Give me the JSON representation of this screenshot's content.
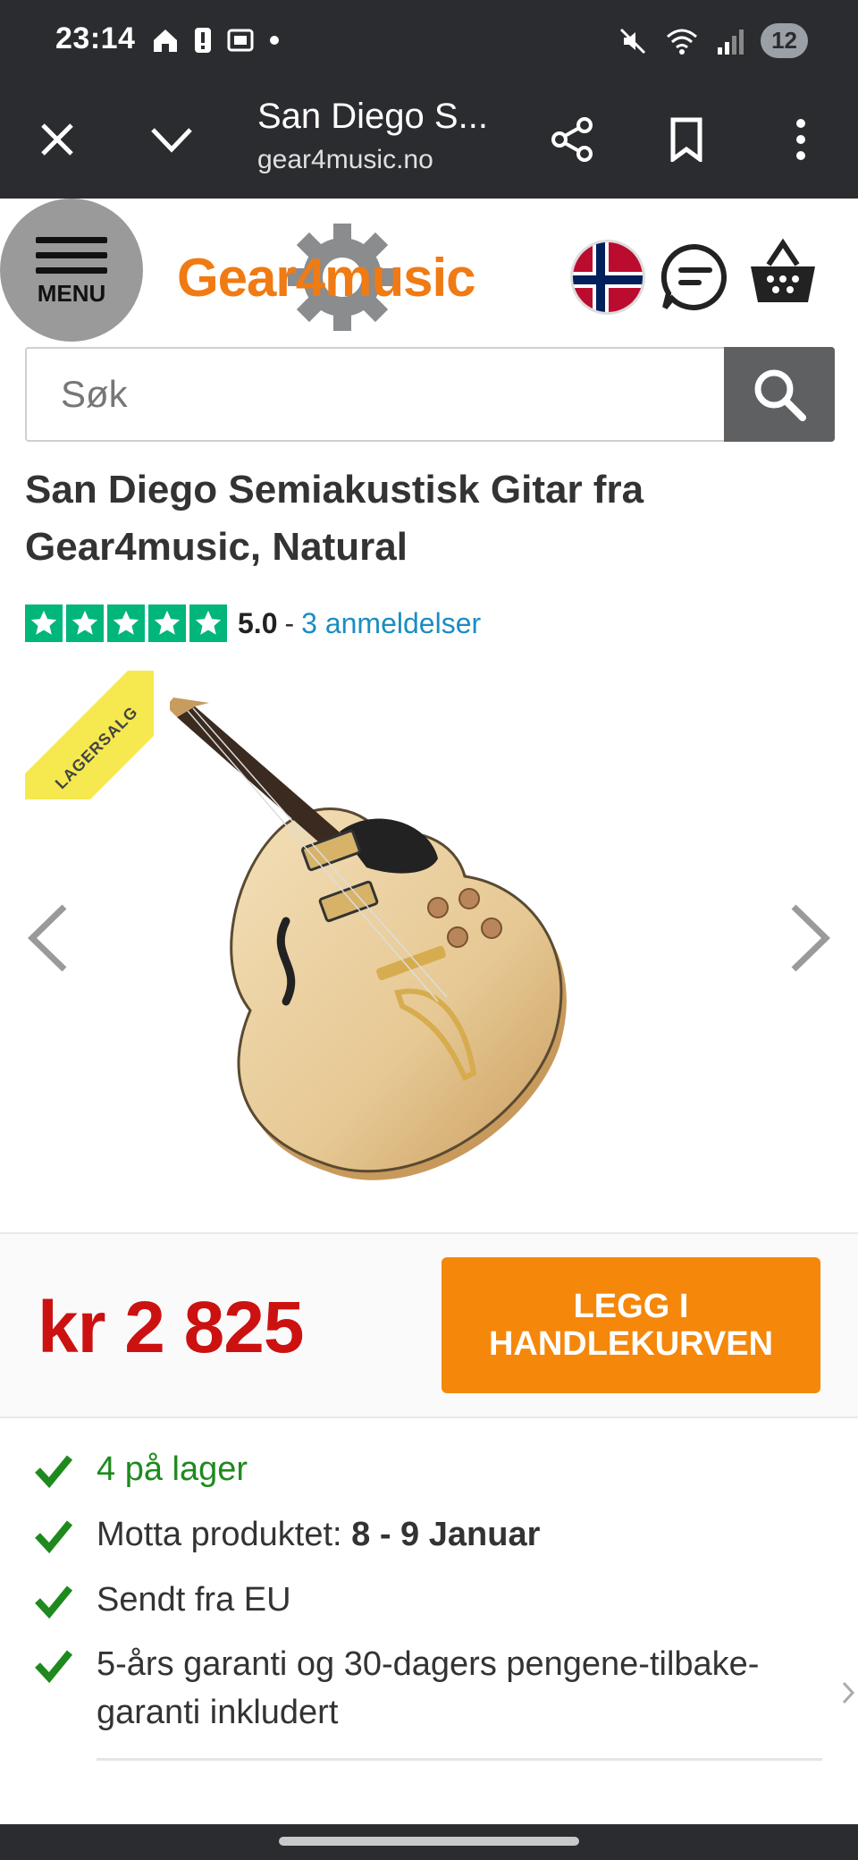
{
  "status_bar": {
    "time": "23:14",
    "notifications": "12"
  },
  "browser": {
    "page_title": "San Diego S...",
    "url": "gear4music.no"
  },
  "header": {
    "menu_label": "MENU",
    "logo_text": "Gear4music"
  },
  "search": {
    "placeholder": "Søk"
  },
  "product": {
    "title": "San Diego Semiakustisk Gitar fra Gear4music, Natural",
    "rating_score": "5.0",
    "rating_separator": "-",
    "reviews_link": "3 anmeldelser",
    "sale_badge": "LAGERSALG",
    "price": "kr 2 825",
    "cart_button": "LEGG I HANDLEKURVEN"
  },
  "features": {
    "stock": "4 på lager",
    "delivery_prefix": "Motta produktet: ",
    "delivery_dates": "8 - 9 Januar",
    "shipping": "Sendt fra EU",
    "warranty": "5-års garanti og 30-dagers pengene-tilbake-garanti inkludert"
  },
  "colors": {
    "brand_orange": "#f07a13",
    "price_red": "#cc1111",
    "cart_orange": "#f5870a",
    "trustpilot_green": "#00b67a",
    "stock_green": "#1e8a1e",
    "link_blue": "#1a8dc4"
  }
}
